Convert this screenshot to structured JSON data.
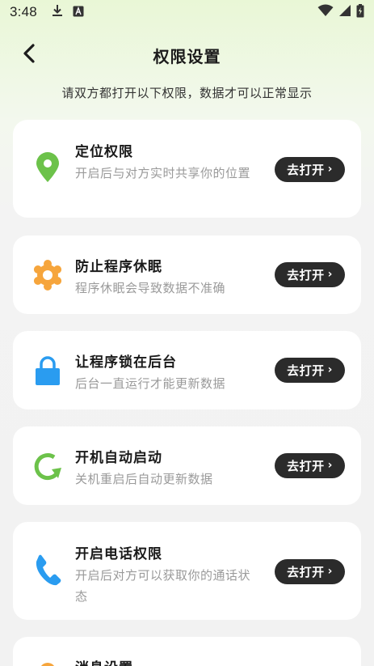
{
  "status_bar": {
    "time": "3:48"
  },
  "header": {
    "title": "权限设置"
  },
  "subtitle": "请双方都打开以下权限，数据才可以正常显示",
  "cards": [
    {
      "title": "定位权限",
      "desc": "开启后与对方实时共享你的位置",
      "action": "去打开",
      "icon": "location-pin-icon",
      "color": "#6cc24a"
    },
    {
      "title": "防止程序休眠",
      "desc": "程序休眠会导致数据不准确",
      "action": "去打开",
      "icon": "gear-icon",
      "color": "#f6a53c"
    },
    {
      "title": "让程序锁在后台",
      "desc": "后台一直运行才能更新数据",
      "action": "去打开",
      "icon": "lock-icon",
      "color": "#2a9cf0"
    },
    {
      "title": "开机自动启动",
      "desc": "关机重启后自动更新数据",
      "action": "去打开",
      "icon": "refresh-icon",
      "color": "#6cc24a"
    },
    {
      "title": "开启电话权限",
      "desc": "开启后对方可以获取你的通话状态",
      "action": "去打开",
      "icon": "phone-icon",
      "color": "#2a9cf0"
    },
    {
      "title": "消息设置",
      "icon": "bell-icon",
      "color": "#f6a53c"
    }
  ]
}
